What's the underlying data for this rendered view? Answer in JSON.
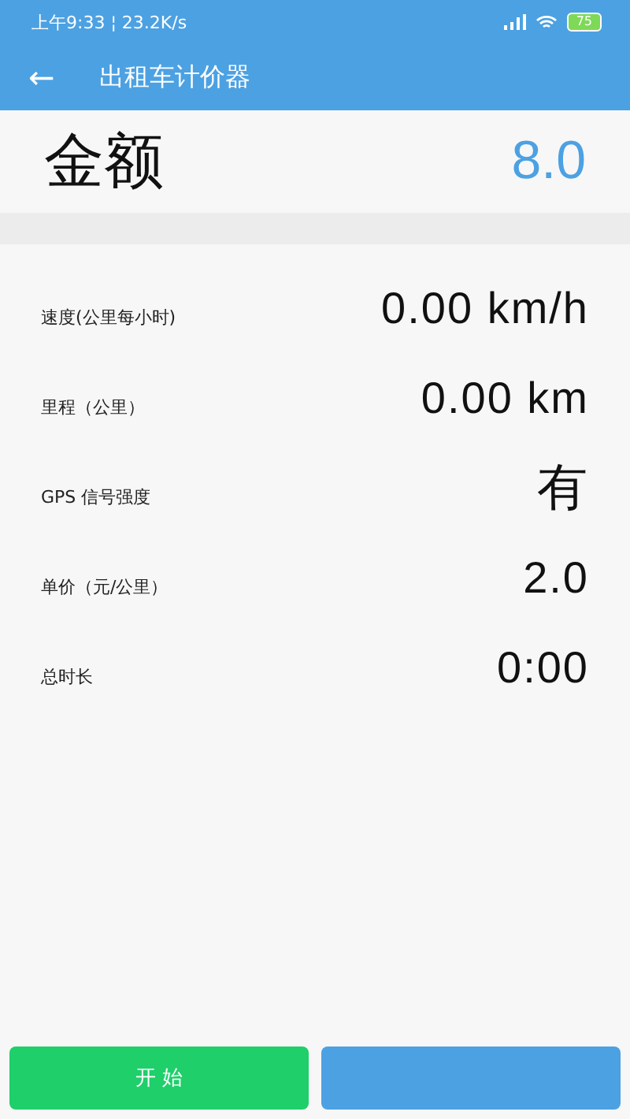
{
  "status_bar": {
    "time": "上午9:33",
    "separator": "¦",
    "speed": "23.2K/s",
    "battery": "75"
  },
  "app_bar": {
    "back": "←",
    "title": "出租车计价器"
  },
  "amount": {
    "label": "金额",
    "value": "8.0"
  },
  "rows": [
    {
      "label": "速度(公里每小时)",
      "value": "0.00 km/h",
      "kind": "number"
    },
    {
      "label": "里程（公里）",
      "value": "0.00 km",
      "kind": "number"
    },
    {
      "label": "GPS 信号强度",
      "value": "有",
      "kind": "cjk"
    },
    {
      "label": "单价（元/公里）",
      "value": "2.0",
      "kind": "number"
    },
    {
      "label": "总时长",
      "value": "0:00",
      "kind": "number"
    }
  ],
  "buttons": [
    {
      "label": "开 始",
      "kind": "start"
    },
    {
      "kind": "secondary"
    }
  ]
}
